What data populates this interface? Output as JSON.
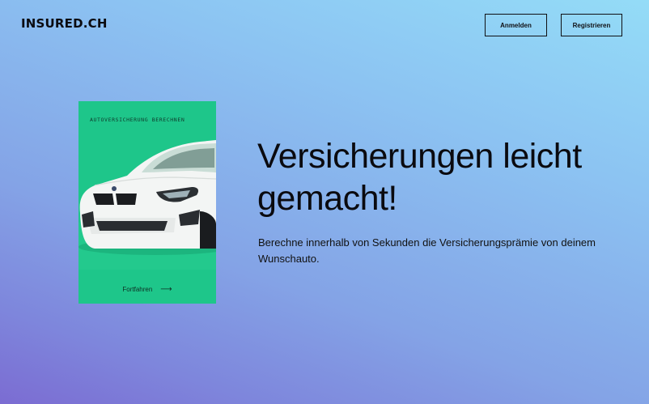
{
  "header": {
    "logo": "INSURED.CH",
    "login_label": "Anmelden",
    "register_label": "Registrieren"
  },
  "card": {
    "title": "AUTOVERSICHERUNG BERECHNEN",
    "cta_label": "Fortfahren",
    "cta_icon": "arrow-right-icon",
    "image": "white-car"
  },
  "hero": {
    "headline": "Versicherungen leicht gemacht!",
    "subtext": "Berechne innerhalb von Sekunden die Versicherungsprämie von deinem Wunschauto."
  },
  "colors": {
    "card_bg": "#1ec68a",
    "gradient_top": "#94dcf7",
    "gradient_bottom": "#7b6cd2"
  }
}
